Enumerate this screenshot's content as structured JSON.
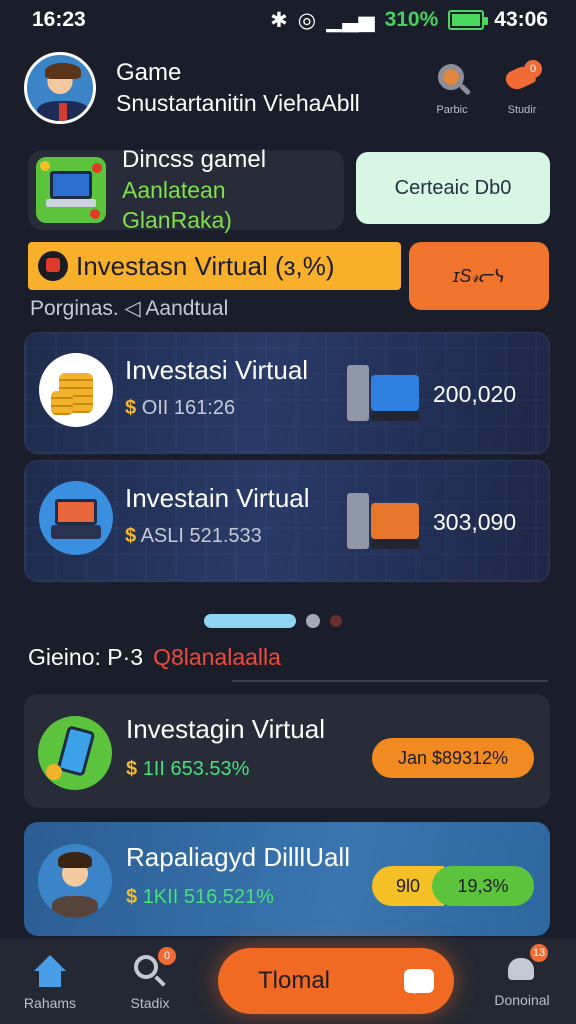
{
  "status_bar": {
    "time_left": "16:23",
    "battery_pct": "310%",
    "time_right": "43:06"
  },
  "header": {
    "title": "Game",
    "subtitle": "Snustartanitin ViehaAbll",
    "btn1_label": "Parbic",
    "btn2_label": "Studir",
    "btn2_badge": "0"
  },
  "game_card": {
    "title": "Dincss gamel",
    "subtitle": "Aanlatean GlanRaka)"
  },
  "cta_button": {
    "label": "Certeaic Db0"
  },
  "invest_banner": {
    "label": "Investasn Virtual (ɜ,%)"
  },
  "orange_button": {
    "label": "ɪS𝓇ᓕᓭ"
  },
  "section_label": "Porginas. ◁ Aandtual",
  "virtual_cards": [
    {
      "title": "Investasi Virtual",
      "dollar": "$",
      "code": "OII",
      "amount": "161:26",
      "value": "200,020"
    },
    {
      "title": "Investain Virtual",
      "dollar": "$",
      "code": "ASLI",
      "amount": "521.533",
      "value": "303,090"
    }
  ],
  "stats": {
    "label": "Gieino: P·3",
    "value": "Q8lanalaalla"
  },
  "promo_cards": [
    {
      "title": "Investagin Virtual",
      "dollar": "$",
      "code": "1II",
      "amount": "653.53%",
      "pill": "Jan $89312%"
    },
    {
      "title": "Rapaliagyd DilllUall",
      "dollar": "$",
      "code": "1KII",
      "amount": "516.521%",
      "pill_a": "9l0",
      "pill_b": "19,3%"
    }
  ],
  "bottom_nav": {
    "home_label": "Rahams",
    "search_label": "Stadix",
    "search_badge": "0",
    "main_label": "Tlomal",
    "right_label": "Donoinal",
    "right_badge": "13"
  },
  "colors": {
    "background": "#1a1e2a",
    "accent_orange": "#f06a24",
    "accent_yellow": "#f8b02a",
    "accent_green": "#47e07a",
    "card_blue": "#2a3a68"
  }
}
